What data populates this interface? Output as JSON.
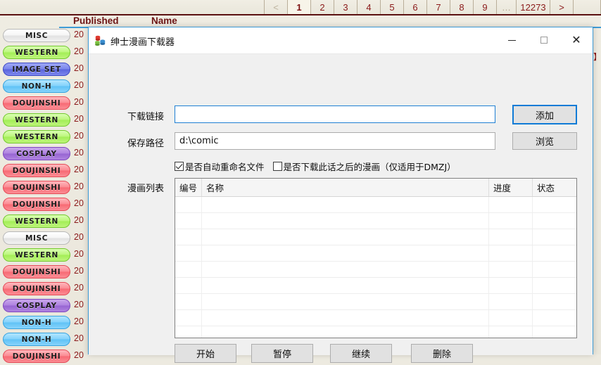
{
  "site": {
    "pager": {
      "prev_label": "<",
      "next_label": ">",
      "ellipsis": "…",
      "pages": [
        "1",
        "2",
        "3",
        "4",
        "5",
        "6",
        "7",
        "8",
        "9"
      ],
      "last_page": "12273",
      "active_page": "1"
    },
    "columns": {
      "published": "Published",
      "name": "Name"
    },
    "rows": [
      {
        "tag": "MISC",
        "kind": "misc",
        "published": "20"
      },
      {
        "tag": "WESTERN",
        "kind": "western",
        "published": "20"
      },
      {
        "tag": "IMAGE SET",
        "kind": "imageset",
        "published": "20"
      },
      {
        "tag": "NON-H",
        "kind": "nonh",
        "published": "20"
      },
      {
        "tag": "DOUJINSHI",
        "kind": "doujinshi",
        "published": "20"
      },
      {
        "tag": "WESTERN",
        "kind": "western",
        "published": "20"
      },
      {
        "tag": "WESTERN",
        "kind": "western",
        "published": "20"
      },
      {
        "tag": "COSPLAY",
        "kind": "cosplay",
        "published": "20"
      },
      {
        "tag": "DOUJINSHI",
        "kind": "doujinshi",
        "published": "20"
      },
      {
        "tag": "DOUJINSHI",
        "kind": "doujinshi",
        "published": "20"
      },
      {
        "tag": "DOUJINSHI",
        "kind": "doujinshi",
        "published": "20"
      },
      {
        "tag": "WESTERN",
        "kind": "western",
        "published": "20"
      },
      {
        "tag": "MISC",
        "kind": "misc",
        "published": "20"
      },
      {
        "tag": "WESTERN",
        "kind": "western",
        "published": "20"
      },
      {
        "tag": "DOUJINSHI",
        "kind": "doujinshi",
        "published": "20"
      },
      {
        "tag": "DOUJINSHI",
        "kind": "doujinshi",
        "published": "20"
      },
      {
        "tag": "COSPLAY",
        "kind": "cosplay",
        "published": "20"
      },
      {
        "tag": "NON-H",
        "kind": "nonh",
        "published": "20"
      },
      {
        "tag": "NON-H",
        "kind": "nonh",
        "published": "20"
      },
      {
        "tag": "DOUJINSHI",
        "kind": "doujinshi",
        "published": "20"
      }
    ],
    "edge_text": "】"
  },
  "dialog": {
    "title": "绅士漫画下载器",
    "window_buttons": {
      "minimize": "—",
      "maximize": "",
      "close": "✕"
    },
    "fields": {
      "link_label": "下载链接",
      "link_value": "",
      "link_placeholder": "",
      "path_label": "保存路径",
      "path_value": "d:\\comic",
      "path_placeholder": ""
    },
    "buttons": {
      "add": "添加",
      "browse": "浏览"
    },
    "checkboxes": [
      {
        "label": "是否自动重命名文件",
        "checked": true
      },
      {
        "label": "是否下载此话之后的漫画（仅适用于DMZJ）",
        "checked": false
      }
    ],
    "list_label": "漫画列表",
    "grid": {
      "headers": [
        "编号",
        "名称",
        "进度",
        "状态"
      ],
      "rows": []
    },
    "actions": [
      "开始",
      "暂停",
      "继续",
      "删除"
    ]
  },
  "colors": {
    "page_bg": "#EDEAE0",
    "rule": "#5B1111",
    "header_text": "#6E1414",
    "accent_blue": "#3E9BD5",
    "focus_blue": "#0F7BD6",
    "dialog_bg": "#F0F0F0"
  }
}
